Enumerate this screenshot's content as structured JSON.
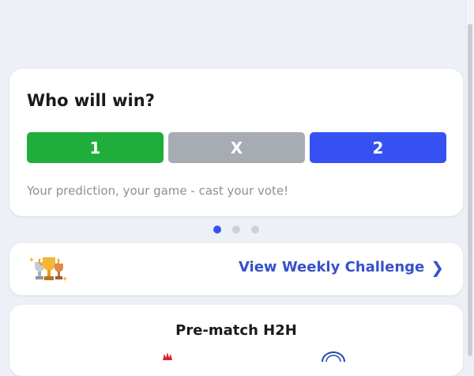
{
  "poll": {
    "title": "Who will win?",
    "options": [
      "1",
      "X",
      "2"
    ],
    "subtitle": "Your prediction, your game - cast your vote!",
    "colors": {
      "home": "#1fae3c",
      "draw": "#a7abb2",
      "away": "#3651f3"
    }
  },
  "carousel": {
    "total": 3,
    "active": 0
  },
  "challenge": {
    "icon": "trophies-icon",
    "link_label": "View Weekly Challenge",
    "chevron": "❯"
  },
  "h2h": {
    "title": "Pre-match H2H",
    "home_logo": "team-crest-icon",
    "away_logo": "team-crest-icon"
  }
}
